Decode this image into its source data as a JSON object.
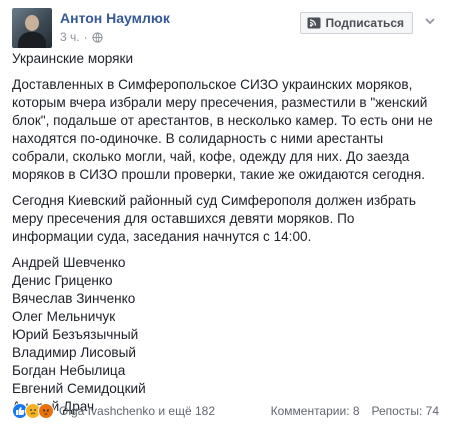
{
  "post": {
    "author": "Антон Наумлюк",
    "time": "3 ч.",
    "follow_label": "Подписаться",
    "title": "Украинские моряки",
    "paragraphs": [
      "Доставленных в Симферопольское СИЗО украинских моряков, которым вчера избрали меру пресечения, разместили в \"женский блок\", подальше от арестантов, в несколько камер. То есть они не находятся по-одиночке. В солидарность с ними арестанты собрали, сколько могли, чай, кофе, одежду для них. До заезда моряков в СИЗО прошли проверки, такие же ожидаются сегодня.",
      "Сегодня Киевский районный суд Симферополя должен избрать меру пресечения для оставшихся девяти моряков. По информации суда, заседания начнутся с 14:00."
    ],
    "names": [
      "Андрей Шевченко",
      "Денис Гриценко",
      "Вячеслав Зинченко",
      "Олег Мельничук",
      "Юрий Безъязычный",
      "Владимир Лисовый",
      "Богдан Небылица",
      "Евгений Семидоцкий",
      "Андрей Драч"
    ]
  },
  "footer": {
    "reactions_text": "Olga Ivashchenko и ещё 182",
    "comments_label": "Комментарии: 8",
    "shares_label": "Репосты: 74"
  },
  "colors": {
    "author_link": "#365899",
    "meta_gray": "#90949c",
    "like_blue": "#1877f2",
    "sad_yellow": "#f7b125",
    "angry_orange": "#e9710f"
  },
  "icons": {
    "globe": "globe-icon",
    "follow": "rss-icon",
    "more": "chevron-down-icon"
  }
}
